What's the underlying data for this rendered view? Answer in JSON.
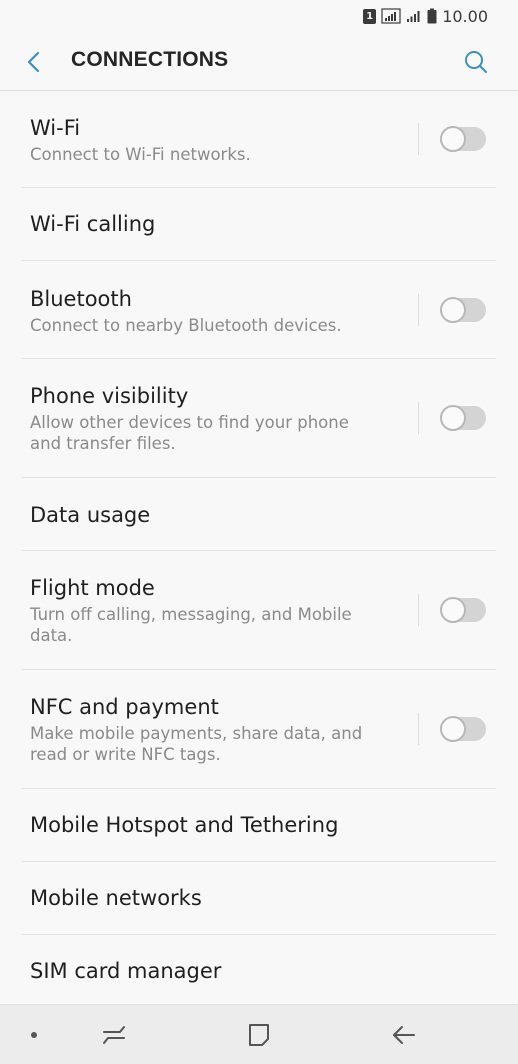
{
  "status_bar": {
    "sim_label": "1",
    "time": "10.00"
  },
  "header": {
    "title": "CONNECTIONS"
  },
  "settings": [
    {
      "title": "Wi-Fi",
      "subtitle": "Connect to Wi-Fi networks.",
      "has_toggle": true,
      "enabled": false
    },
    {
      "title": "Wi-Fi calling",
      "subtitle": "",
      "has_toggle": false
    },
    {
      "title": "Bluetooth",
      "subtitle": "Connect to nearby Bluetooth devices.",
      "has_toggle": true,
      "enabled": false
    },
    {
      "title": "Phone visibility",
      "subtitle": "Allow other devices to find your phone and transfer files.",
      "has_toggle": true,
      "enabled": false
    },
    {
      "title": "Data usage",
      "subtitle": "",
      "has_toggle": false
    },
    {
      "title": "Flight mode",
      "subtitle": "Turn off calling, messaging, and Mobile data.",
      "has_toggle": true,
      "enabled": false
    },
    {
      "title": "NFC and payment",
      "subtitle": "Make mobile payments, share data, and read or write NFC tags.",
      "has_toggle": true,
      "enabled": false
    },
    {
      "title": "Mobile Hotspot and Tethering",
      "subtitle": "",
      "has_toggle": false
    },
    {
      "title": "Mobile networks",
      "subtitle": "",
      "has_toggle": false
    },
    {
      "title": "SIM card manager",
      "subtitle": "",
      "has_toggle": false
    }
  ],
  "colors": {
    "accent": "#3d8fbf",
    "background": "#f8f8f8"
  },
  "icons": {
    "back": "chevron-left-icon",
    "search": "search-icon",
    "recents": "recents-icon",
    "home": "home-icon",
    "nav_back": "back-arrow-icon"
  }
}
